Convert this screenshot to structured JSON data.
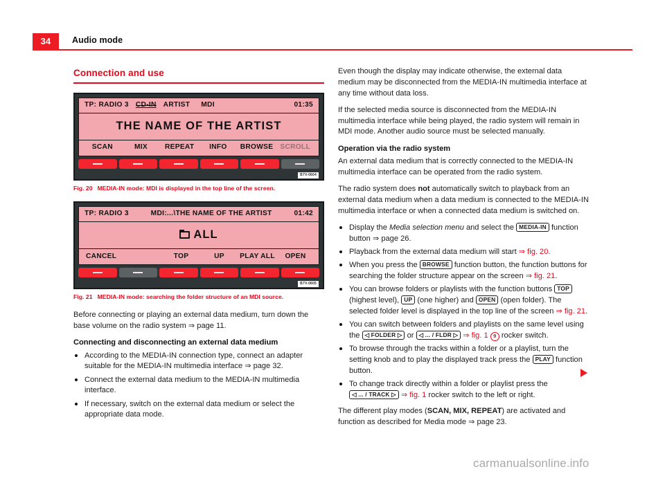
{
  "header": {
    "page_number": "34",
    "title": "Audio mode"
  },
  "left_column": {
    "section_heading": "Connection and use",
    "figures": [
      {
        "id": "fig-20",
        "caption_number": "Fig. 20",
        "caption_text": "MEDIA-IN mode: MDI is displayed in the top line of the screen.",
        "image_code": "B7V-0604",
        "screen": {
          "top_line": {
            "source": "TP: RADIO 3",
            "input": "CD-IN",
            "label": "ARTIST",
            "mode": "MDI",
            "time": "01:35"
          },
          "middle_line": "THE NAME OF THE ARTIST",
          "function_row": [
            "SCAN",
            "MIX",
            "REPEAT",
            "INFO",
            "BROWSE",
            "SCROLL"
          ],
          "dimmed_function": "SCROLL",
          "hardware_buttons": [
            "active",
            "active",
            "active",
            "active",
            "active",
            "inactive"
          ]
        }
      },
      {
        "id": "fig-21",
        "caption_number": "Fig. 21",
        "caption_text": "MEDIA-IN mode: searching the folder structure of an MDI source.",
        "image_code": "B7V-0605",
        "screen": {
          "top_line": {
            "source": "TP: RADIO 3",
            "path": "MDI:...\\THE NAME OF THE ARTIST",
            "time": "01:42"
          },
          "middle_line": "ALL",
          "middle_line_icon": "folder-icon",
          "function_row": [
            "CANCEL",
            "",
            "TOP",
            "UP",
            "PLAY ALL",
            "OPEN"
          ],
          "hardware_buttons": [
            "active",
            "inactive",
            "active",
            "active",
            "active",
            "active"
          ]
        }
      }
    ],
    "intro_paragraph_a": "Before connecting or playing an external data medium, turn down the base volume on the radio system ",
    "intro_paragraph_a_ref": "⇒ page 11.",
    "subheading": "Connecting and disconnecting an external data medium",
    "bullets": [
      {
        "pre": "According to the MEDIA-IN connection type, connect an adapter suitable for the MEDIA-IN multimedia interface ",
        "ref": "⇒ page 32.",
        "post": ""
      },
      {
        "pre": "Connect the external data medium to the MEDIA-IN multimedia interface.",
        "ref": "",
        "post": ""
      },
      {
        "pre": "If necessary, switch on the external data medium or select the appropriate data mode.",
        "ref": "",
        "post": ""
      }
    ]
  },
  "right_column": {
    "paragraph_1": "Even though the display may indicate otherwise, the external data medium may be disconnected from the MEDIA-IN multimedia interface at any time without data loss.",
    "paragraph_2": "If the selected media source is disconnected from the MEDIA-IN multimedia interface while being played, the radio system will remain in MDI mode. Another audio source must be selected manually.",
    "subheading": "Operation via the radio system",
    "paragraph_3": "An external data medium that is correctly connected to the MEDIA-IN multimedia interface can be operated from the radio system.",
    "paragraph_4_a": "The radio system does ",
    "paragraph_4_bold": "not",
    "paragraph_4_b": " automatically switch to playback from an external data medium when a data medium is connected to the MEDIA-IN multimedia interface or when a connected data medium is switched on.",
    "bullets": [
      {
        "text_a": "Display the ",
        "italic": "Media selection menu",
        "text_b": " and select the ",
        "key": "MEDIA-IN",
        "text_c": " function button ",
        "ref": "⇒ page 26.",
        "text_d": ""
      },
      {
        "text_a": "Playback from the external data medium will start ",
        "ref_red": "⇒ fig. 20",
        "text_b": "."
      },
      {
        "text_a": "When you press the ",
        "key": "BROWSE",
        "text_b": " function button, the function buttons for searching the folder structure appear on the screen ",
        "ref_red": "⇒ fig. 21",
        "text_c": "."
      },
      {
        "text_a": "You can browse folders or playlists with the function buttons ",
        "key1": "TOP",
        "text_b": " (highest level), ",
        "key2": "UP",
        "text_c": " (one higher) and ",
        "key3": "OPEN",
        "text_d": " (open folder). The selected folder level is displayed in the top line of the screen ",
        "ref_red": "⇒ fig. 21",
        "text_e": "."
      },
      {
        "text_a": "You can switch between folders and playlists on the same level using the ",
        "key1": "◁ FOLDER ▷",
        "text_b": " or ",
        "key2": "◁ ... / FLDR ▷",
        "text_c": " ",
        "ref_red": "⇒ fig. 1",
        "circle_num": "9",
        "text_d": " rocker switch."
      },
      {
        "text_a": "To browse through the tracks within a folder or a playlist, turn the setting knob and to play the displayed track press the ",
        "key": "PLAY",
        "text_b": " function button."
      },
      {
        "text_a": "To change track directly within a folder or playlist press the ",
        "key": "◁ ... / TRACK ▷",
        "text_b": " ",
        "ref_red": "⇒ fig. 1",
        "text_c": " rocker switch to the left or right."
      }
    ],
    "closing_a": "The different play modes (",
    "closing_modes": "SCAN, MIX, REPEAT",
    "closing_b": ") are activated and function as described for Media mode ",
    "closing_ref": "⇒ page 23."
  },
  "watermark": "carmanualsonline.info",
  "colors": {
    "brand_red": "#ec1c24",
    "heading_red": "#e2071b",
    "screen_pink": "#f3a7ae",
    "unit_dark": "#2f3436",
    "button_red": "#f3252f",
    "button_inactive": "#5c6264"
  }
}
